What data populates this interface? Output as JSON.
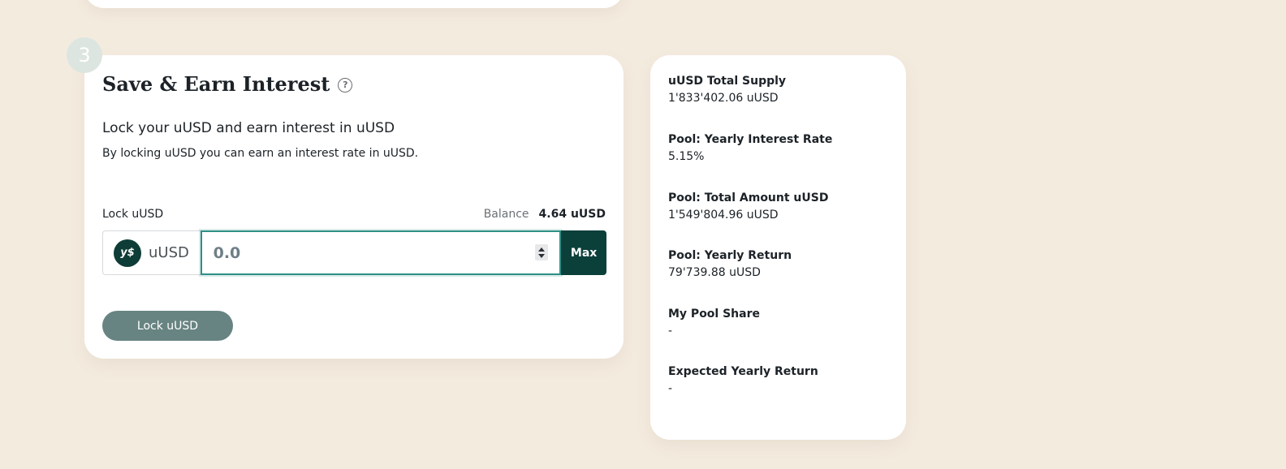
{
  "step": {
    "number": "3"
  },
  "save_card": {
    "title": "Save & Earn Interest",
    "subtitle": "Lock your uUSD and earn interest in uUSD",
    "description": "By locking uUSD you can earn an interest rate in uUSD.",
    "field_label": "Lock uUSD",
    "balance_label": "Balance",
    "balance_value": "4.64 uUSD",
    "token_name": "uUSD",
    "token_logo_text": "y$",
    "amount_placeholder": "0.0",
    "amount_value": "",
    "max_label": "Max",
    "lock_button_label": "Lock uUSD"
  },
  "stats": [
    {
      "label": "uUSD Total Supply",
      "value": "1'833'402.06 uUSD"
    },
    {
      "label": "Pool: Yearly Interest Rate",
      "value": "5.15%"
    },
    {
      "label": "Pool: Total Amount uUSD",
      "value": "1'549'804.96 uUSD"
    },
    {
      "label": "Pool: Yearly Return",
      "value": "79'739.88 uUSD"
    },
    {
      "label": "My Pool Share",
      "value": "-"
    },
    {
      "label": "Expected Yearly Return",
      "value": "-"
    }
  ],
  "colors": {
    "background": "#f4ebdf",
    "accent_dark": "#0b3f3a",
    "button_muted": "#678482",
    "input_focus": "#2f8f86"
  },
  "icons": {
    "help": "help-circle-icon",
    "token": "uusd-token-icon",
    "spinner": "number-spinner-icon"
  }
}
